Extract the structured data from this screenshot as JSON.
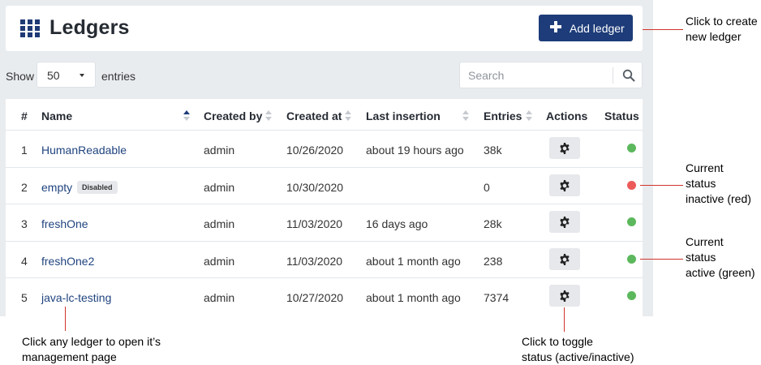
{
  "header": {
    "title": "Ledgers",
    "add_button_label": "Add ledger"
  },
  "controls": {
    "show_label": "Show",
    "entries_value": "50",
    "entries_label": "entries",
    "search_placeholder": "Search"
  },
  "table": {
    "columns": [
      "#",
      "Name",
      "Created by",
      "Created at",
      "Last insertion",
      "Entries",
      "Actions",
      "Status"
    ],
    "rows": [
      {
        "num": "1",
        "name": "HumanReadable",
        "badge": "",
        "created_by": "admin",
        "created_at": "10/26/2020",
        "last_insertion": "about 19 hours ago",
        "entries": "38k",
        "status": "active"
      },
      {
        "num": "2",
        "name": "empty",
        "badge": "Disabled",
        "created_by": "admin",
        "created_at": "10/30/2020",
        "last_insertion": "",
        "entries": "0",
        "status": "inactive"
      },
      {
        "num": "3",
        "name": "freshOne",
        "badge": "",
        "created_by": "admin",
        "created_at": "11/03/2020",
        "last_insertion": "16 days ago",
        "entries": "28k",
        "status": "active"
      },
      {
        "num": "4",
        "name": "freshOne2",
        "badge": "",
        "created_by": "admin",
        "created_at": "11/03/2020",
        "last_insertion": "about 1 month ago",
        "entries": "238",
        "status": "active"
      },
      {
        "num": "5",
        "name": "java-lc-testing",
        "badge": "",
        "created_by": "admin",
        "created_at": "10/27/2020",
        "last_insertion": "about 1 month ago",
        "entries": "7374",
        "status": "active"
      }
    ]
  },
  "colors": {
    "accent": "#1d3c79",
    "active": "#5cb85c",
    "inactive": "#ed5a5a",
    "callout_line": "#d0342c"
  },
  "annotations": {
    "add_ledger": [
      "Click to create",
      "new ledger"
    ],
    "inactive": [
      "Current",
      "status",
      "inactive (red)"
    ],
    "active": [
      "Current",
      "status",
      "active (green)"
    ],
    "open_ledger": [
      "Click any ledger to open it’s",
      "management page"
    ],
    "toggle": [
      "Click to toggle",
      "status (active/inactive)"
    ]
  }
}
